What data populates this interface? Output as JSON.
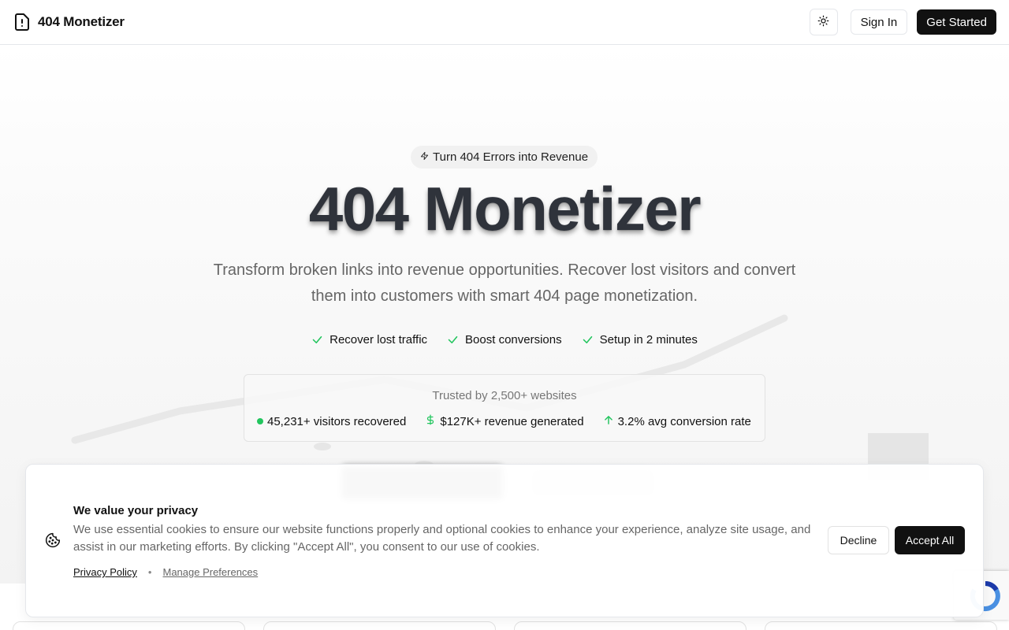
{
  "header": {
    "brand_name": "404 Monetizer",
    "signin_label": "Sign In",
    "get_started_label": "Get Started"
  },
  "hero": {
    "badge": "Turn 404 Errors into Revenue",
    "title": "404 Monetizer",
    "subtitle": "Transform broken links into revenue opportunities. Recover lost visitors and convert them into customers with smart 404 page monetization.",
    "features": [
      "Recover lost traffic",
      "Boost conversions",
      "Setup in 2 minutes"
    ],
    "trusted": "Trusted by 2,500+ websites",
    "stats": [
      "45,231+ visitors recovered",
      "$127K+ revenue generated",
      "3.2% avg conversion rate"
    ]
  },
  "cookie": {
    "title": "We value your privacy",
    "text": "We use essential cookies to ensure our website functions properly and optional cookies to enhance your experience, analyze site usage, and assist in our marketing efforts. By clicking \"Accept All\", you consent to our use of cookies.",
    "privacy_link": "Privacy Policy",
    "separator": "•",
    "manage_link": "Manage Preferences",
    "decline_label": "Decline",
    "accept_label": "Accept All"
  },
  "colors": {
    "accent": "#111111",
    "success": "#22c55e"
  },
  "icons": [
    "file-alert-icon",
    "sun-icon",
    "zap-icon",
    "check-icon",
    "dollar-icon",
    "arrow-up-icon",
    "cookie-icon"
  ]
}
